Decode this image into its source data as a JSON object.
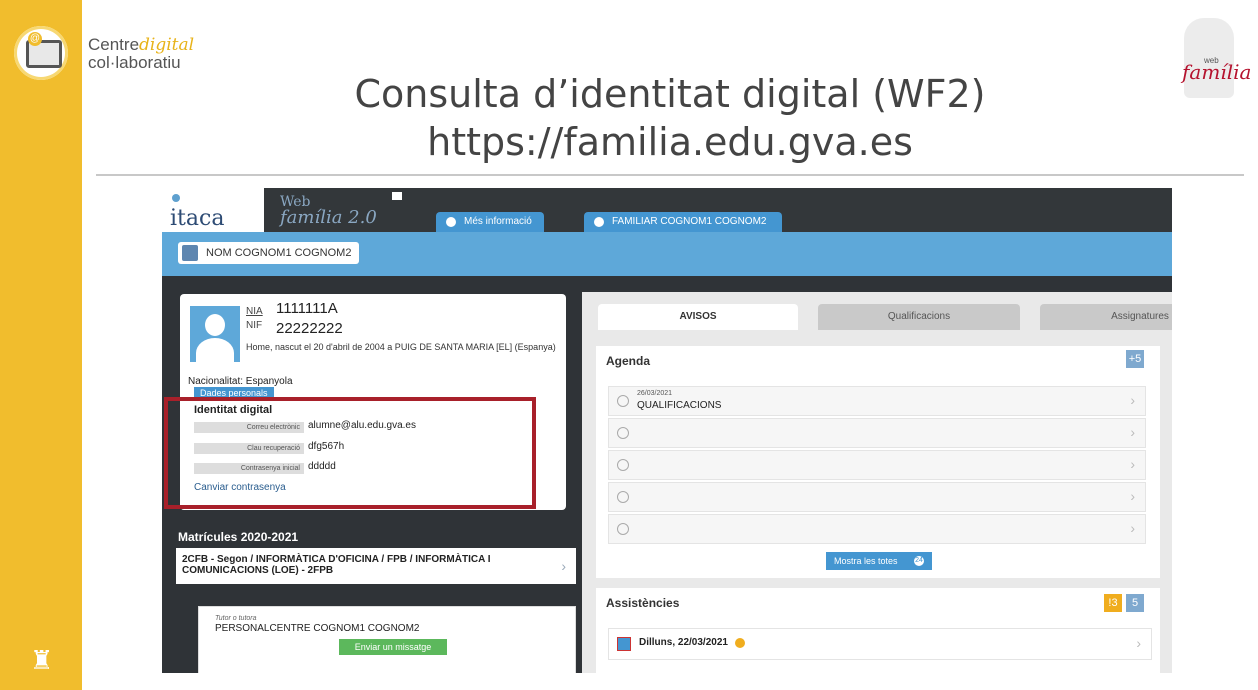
{
  "slide": {
    "brand_line1_a": "Centre",
    "brand_line1_b": "digital",
    "brand_line2": "col·laboratiu",
    "title_line1": "Consulta d’identitat digital (WF2)",
    "title_line2": "https://familia.edu.gva.es",
    "wf_logo_small": "web",
    "wf_logo_big": "família"
  },
  "app": {
    "logo": "itaca",
    "product_a": "Web",
    "product_b": "família 2.0",
    "tab_info": "Més informació",
    "tab_familiar": "FAMILIAR COGNOM1 COGNOM2",
    "student_name": "NOM COGNOM1 COGNOM2"
  },
  "profile": {
    "nia_label": "NIA",
    "nia_value": "1111111A",
    "nif_label": "NIF",
    "nif_value": "22222222",
    "description": "Home, nascut el 20 d'abril de 2004 a PUIG DE SANTA MARIA [EL] (Espanya)",
    "nationality": "Nacionalitat: Espanyola",
    "personal_data_button": "Dades personals",
    "identity_title": "Identitat digital",
    "email_label": "Correu electrònic",
    "email_value": "alumne@alu.edu.gva.es",
    "recovery_label": "Clau recuperació",
    "recovery_value": "dfg567h",
    "initial_pwd_label": "Contrasenya inicial",
    "initial_pwd_value": "ddddd",
    "change_password_link": "Canviar contrasenya"
  },
  "enrollments": {
    "header": "Matrícules 2020-2021",
    "item": "2CFB - Segon / INFORMÀTICA D'OFICINA / FPB / INFORMÀTICA I COMUNICACIONS (LOE) - 2FPB",
    "tutor_label": "Tutor o tutora",
    "tutor_name": "PERSONALCENTRE COGNOM1 COGNOM2",
    "send_message_button": "Enviar un missatge"
  },
  "tabs": {
    "avisos": "AVISOS",
    "qualificacions": "Qualificacions",
    "assignatures": "Assignatures"
  },
  "agenda": {
    "header": "Agenda",
    "badge": "+5",
    "first_date": "26/03/2021",
    "first_title": "QUALIFICACIONS",
    "show_all_button": "Mostra les totes",
    "show_all_count": "24"
  },
  "assistencies": {
    "header": "Assistències",
    "badge_warning": "!3",
    "badge_count": "5",
    "row_date": "Dilluns, 22/03/2021"
  },
  "colors": {
    "sidebar": "#f1bd2d",
    "highlight_box": "#a8202a",
    "accent_blue": "#4496d1",
    "dark_bg": "#2f3337"
  }
}
